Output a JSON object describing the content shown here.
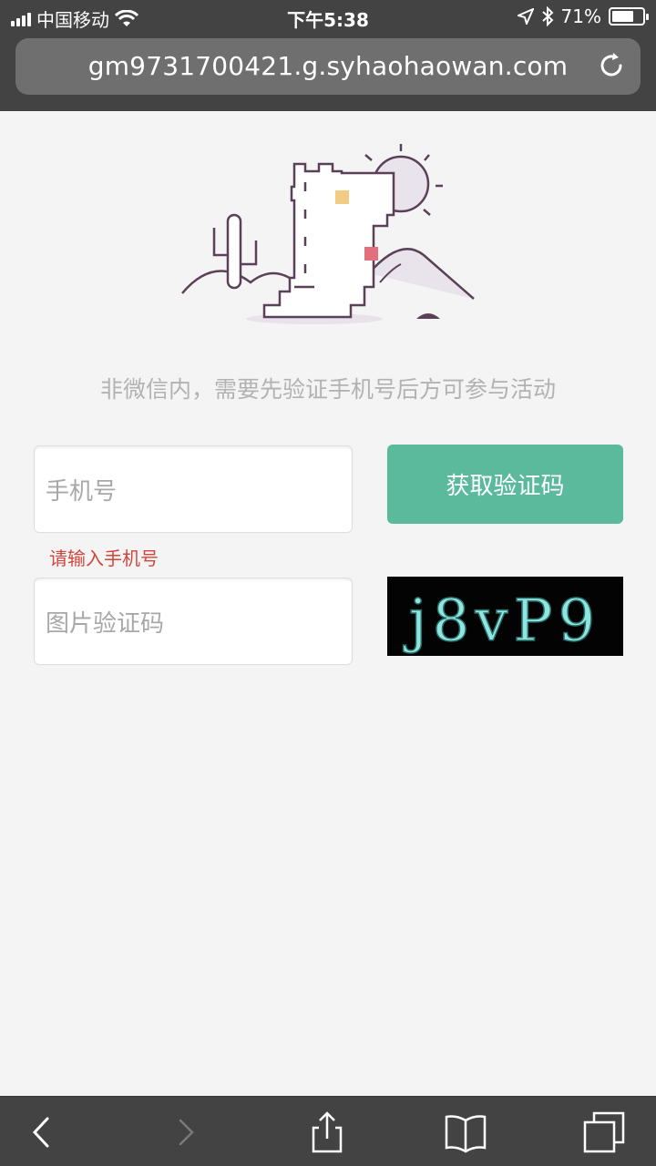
{
  "status_bar": {
    "carrier": "中国移动",
    "time": "下午5:38",
    "battery": "71%",
    "battery_level": 0.71
  },
  "browser": {
    "url": "gm9731700421.g.syhaohaowan.com"
  },
  "page": {
    "notice": "非微信内，需要先验证手机号后方可参与活动",
    "phone_placeholder": "手机号",
    "phone_error": "请输入手机号",
    "captcha_placeholder": "图片验证码",
    "get_code_button": "获取验证码",
    "captcha_text": "j8vP9"
  },
  "colors": {
    "accent": "#5cba9c",
    "error": "#d0463c",
    "chrome": "#434343",
    "captcha_text": "#8fe6e0"
  },
  "toolbar": {
    "icons": [
      "back-icon",
      "forward-icon",
      "share-icon",
      "bookmarks-icon",
      "tabs-icon"
    ]
  }
}
